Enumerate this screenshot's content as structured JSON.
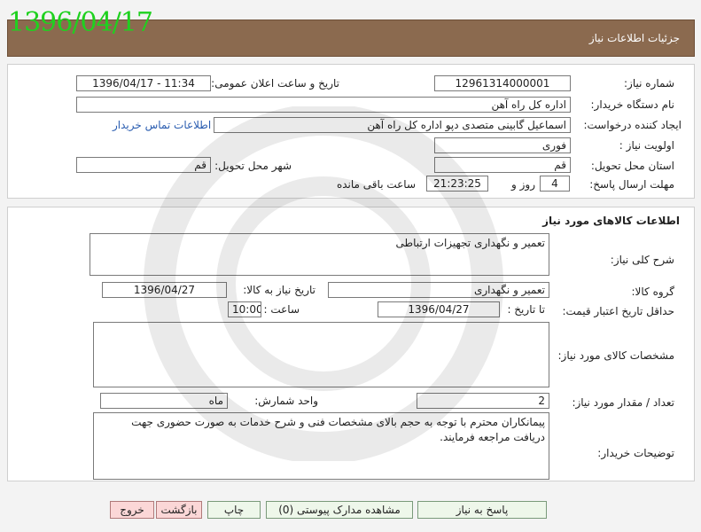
{
  "header": {
    "title": "جزئیات اطلاعات نیاز",
    "stamp_date": "1396/04/17"
  },
  "need_info": {
    "need_number_label": "شماره نیاز:",
    "need_number": "12961314000001",
    "announce_label": "تاریخ و ساعت اعلان عمومی:",
    "announce_value": "1396/04/17 - 11:34",
    "buyer_org_label": "نام دستگاه خریدار:",
    "buyer_org": "اداره کل راه آهن",
    "creator_label": "ایجاد کننده درخواست:",
    "creator": "اسماعیل گابینی متصدی دپو اداره کل راه آهن",
    "contact_link": "اطلاعات تماس خریدار",
    "priority_label": "اولویت نیاز :",
    "priority": "فوری",
    "province_label": "استان محل تحویل:",
    "province": "قم",
    "city_label": "شهر محل تحویل:",
    "city": "قم",
    "deadline_label": "مهلت ارسال پاسخ:",
    "days": "4",
    "days_label": "روز و",
    "time_left": "21:23:25",
    "time_left_label": "ساعت باقی مانده"
  },
  "goods": {
    "section_title": "اطلاعات کالاهای مورد نیاز",
    "summary_label": "شرح کلی نیاز:",
    "summary": "تعمیر و نگهداری تجهیزات ارتباطی",
    "group_label": "گروه کالا:",
    "group": "تعمیر و نگهداری",
    "need_date_label": "تاریخ نیاز به کالا:",
    "need_date": "1396/04/27",
    "min_validity_label": "حداقل تاریخ اعتبار قیمت:",
    "to_date_label": "تا تاریخ :",
    "to_date": "1396/04/27",
    "time_label": "ساعت :",
    "time": "10:00",
    "specs_label": "مشخصات کالای مورد نیاز:",
    "specs": "",
    "qty_label": "تعداد / مقدار مورد نیاز:",
    "qty": "2",
    "unit_label": "واحد شمارش:",
    "unit": "ماه",
    "desc_label": "توضیحات خریدار:",
    "desc": "پیمانکاران محترم با توجه به حجم بالای مشخصات فنی و شرح خدمات  به صورت حضوری جهت دریافت مراجعه فرمایند."
  },
  "buttons": {
    "reply": "پاسخ به نیاز",
    "attachments": "مشاهده مدارک پیوستی (0)",
    "print": "چاپ",
    "back": "بازگشت",
    "exit": "خروج"
  },
  "colors": {
    "header_bg": "#8b6a4f",
    "stamp": "#1fd11f",
    "link": "#2a5db0"
  }
}
